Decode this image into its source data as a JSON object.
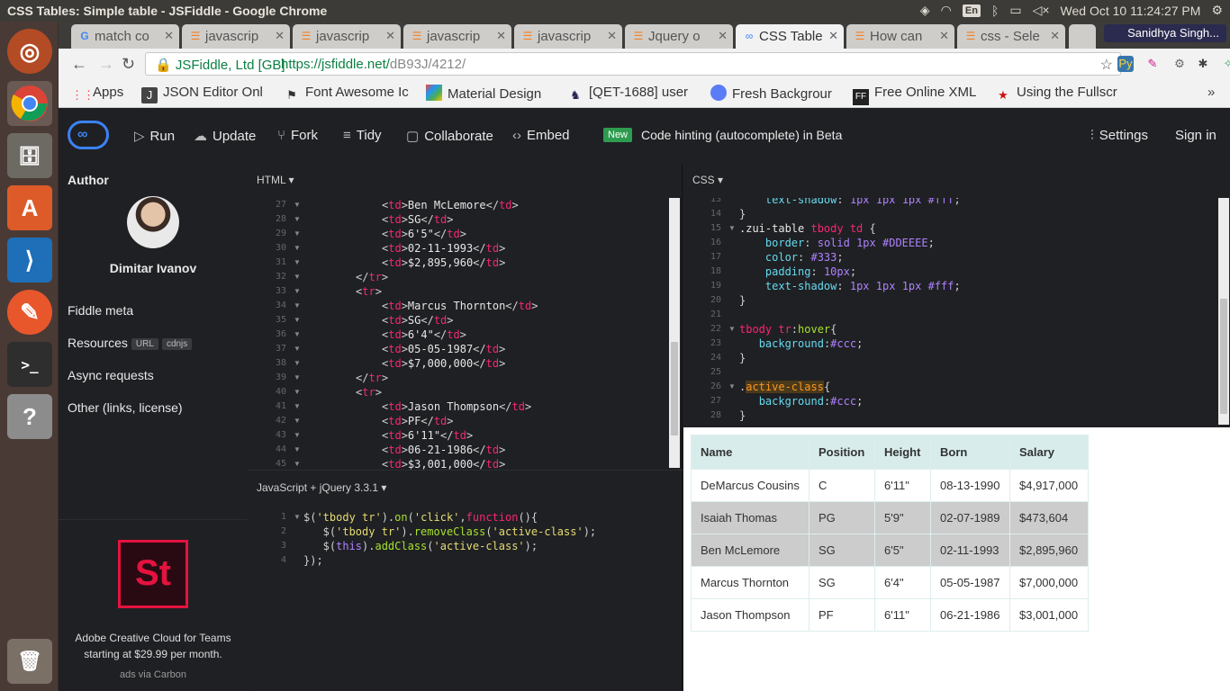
{
  "os": {
    "window_title": "CSS Tables: Simple table - JSFiddle - Google Chrome",
    "lang": "En",
    "clock": "Wed Oct 10 11:24:27 PM"
  },
  "browser": {
    "tabs": [
      {
        "label": "match co",
        "icon": "google-icon",
        "active": false
      },
      {
        "label": "javascrip",
        "icon": "stackoverflow-icon",
        "active": false
      },
      {
        "label": "javascrip",
        "icon": "stackoverflow-icon",
        "active": false
      },
      {
        "label": "javascrip",
        "icon": "stackoverflow-icon",
        "active": false
      },
      {
        "label": "javascrip",
        "icon": "stackoverflow-icon",
        "active": false
      },
      {
        "label": "Jquery o",
        "icon": "stackoverflow-icon",
        "active": false
      },
      {
        "label": "CSS Table",
        "icon": "jsfiddle-icon",
        "active": true
      },
      {
        "label": "How can",
        "icon": "stackoverflow-icon",
        "active": false
      },
      {
        "label": "css - Sele",
        "icon": "stackoverflow-icon",
        "active": false
      }
    ],
    "profile": "Sanidhya Singh...",
    "secure_label": "JSFiddle, Ltd [GB]",
    "url_host": "https://jsfiddle.net/",
    "url_path": "dB93J/4212/",
    "bookmarks": [
      {
        "label": "Apps"
      },
      {
        "label": "JSON Editor Onl"
      },
      {
        "label": "Font Awesome Ic"
      },
      {
        "label": "Material Design"
      },
      {
        "label": "[QET-1688] user"
      },
      {
        "label": "Fresh Backgrour"
      },
      {
        "label": "Free Online XML"
      },
      {
        "label": "Using the Fullscr"
      }
    ]
  },
  "jsfiddle": {
    "buttons": {
      "run": "Run",
      "update": "Update",
      "fork": "Fork",
      "tidy": "Tidy",
      "collaborate": "Collaborate",
      "embed": "Embed"
    },
    "new_badge": "New",
    "hinting": "Code hinting (autocomplete) in Beta",
    "settings": "Settings",
    "sign_in": "Sign in",
    "sidebar": {
      "author_heading": "Author",
      "author_name": "Dimitar Ivanov",
      "fiddle_meta": "Fiddle meta",
      "resources": "Resources",
      "url_pill": "URL",
      "cdnjs_pill": "cdnjs",
      "async": "Async requests",
      "other": "Other (links, license)",
      "ad_logo": "St",
      "ad_text": "Adobe Creative Cloud for Teams starting at $29.99 per month.",
      "ad_source": "ads via Carbon"
    },
    "html_panel": {
      "header": "HTML ▾",
      "lines": [
        {
          "n": "27",
          "row": "Ben McLemore",
          "kind": "td"
        },
        {
          "n": "28",
          "row": "SG",
          "kind": "td"
        },
        {
          "n": "29",
          "row": "6'5\"",
          "kind": "td"
        },
        {
          "n": "30",
          "row": "02-11-1993",
          "kind": "td"
        },
        {
          "n": "31",
          "row": "$2,895,960",
          "kind": "td"
        },
        {
          "n": "32",
          "row": "",
          "kind": "close"
        },
        {
          "n": "33",
          "row": "",
          "kind": "open"
        },
        {
          "n": "34",
          "row": "Marcus Thornton",
          "kind": "td"
        },
        {
          "n": "35",
          "row": "SG",
          "kind": "td"
        },
        {
          "n": "36",
          "row": "6'4\"",
          "kind": "td"
        },
        {
          "n": "37",
          "row": "05-05-1987",
          "kind": "td"
        },
        {
          "n": "38",
          "row": "$7,000,000",
          "kind": "td"
        },
        {
          "n": "39",
          "row": "",
          "kind": "close"
        },
        {
          "n": "40",
          "row": "",
          "kind": "open"
        },
        {
          "n": "41",
          "row": "Jason Thompson",
          "kind": "td"
        },
        {
          "n": "42",
          "row": "PF",
          "kind": "td"
        },
        {
          "n": "43",
          "row": "6'11\"",
          "kind": "td"
        },
        {
          "n": "44",
          "row": "06-21-1986",
          "kind": "td"
        },
        {
          "n": "45",
          "row": "$3,001,000",
          "kind": "td"
        }
      ]
    },
    "css_panel": {
      "header": "CSS ▾",
      "line_numbers": [
        "13",
        "14",
        "15",
        "16",
        "17",
        "18",
        "19",
        "20",
        "21",
        "22",
        "23",
        "24",
        "25",
        "26",
        "27",
        "28"
      ],
      "code_lines": [
        "    text-shadow: 1px 1px 1px #fff;",
        "}",
        ".zui-table tbody td {",
        "    border: solid 1px #DDEEEE;",
        "    color: #333;",
        "    padding: 10px;",
        "    text-shadow: 1px 1px 1px #fff;",
        "}",
        "",
        "tbody tr:hover{",
        "   background:#ccc;",
        "}",
        "",
        ".active-class{",
        "   background:#ccc;",
        "}"
      ]
    },
    "js_panel": {
      "header": "JavaScript + jQuery 3.3.1 ▾",
      "line_numbers": [
        "1",
        "2",
        "3",
        "4"
      ],
      "code_lines": [
        "$('tbody tr').on('click',function(){",
        "   $('tbody tr').removeClass('active-class');",
        "   $(this).addClass('active-class');",
        "});"
      ]
    },
    "result_table": {
      "headers": [
        "Name",
        "Position",
        "Height",
        "Born",
        "Salary"
      ],
      "rows": [
        [
          "DeMarcus Cousins",
          "C",
          "6'11\"",
          "08-13-1990",
          "$4,917,000"
        ],
        [
          "Isaiah Thomas",
          "PG",
          "5'9\"",
          "02-07-1989",
          "$473,604"
        ],
        [
          "Ben McLemore",
          "SG",
          "6'5\"",
          "02-11-1993",
          "$2,895,960"
        ],
        [
          "Marcus Thornton",
          "SG",
          "6'4\"",
          "05-05-1987",
          "$7,000,000"
        ],
        [
          "Jason Thompson",
          "PF",
          "6'11\"",
          "06-21-1986",
          "$3,001,000"
        ]
      ],
      "highlighted_rows": [
        1,
        2
      ]
    }
  }
}
